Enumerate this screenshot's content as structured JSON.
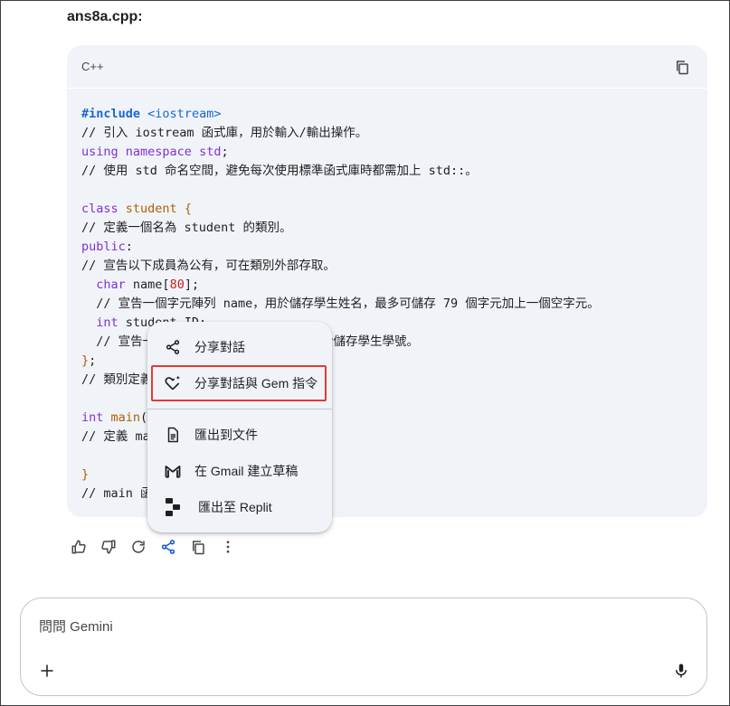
{
  "response": {
    "filename": "ans8a.cpp:"
  },
  "code_block": {
    "language": "C++",
    "copy_icon": "copy-icon",
    "lines": [
      [
        {
          "c": "kw",
          "t": "#include"
        },
        {
          "c": "",
          "t": " "
        },
        {
          "c": "str",
          "t": "<iostream>"
        }
      ],
      [
        {
          "c": "cm",
          "t": "// 引入 iostream 函式庫，用於輸入/輸出操作。"
        }
      ],
      [
        {
          "c": "kw2",
          "t": "using"
        },
        {
          "c": "",
          "t": " "
        },
        {
          "c": "kw2",
          "t": "namespace"
        },
        {
          "c": "",
          "t": " "
        },
        {
          "c": "kw2",
          "t": "std"
        },
        {
          "c": "",
          "t": ";"
        }
      ],
      [
        {
          "c": "cm",
          "t": "// 使用 std 命名空間，避免每次使用標準函式庫時都需加上 std::。"
        }
      ],
      [
        {
          "c": "",
          "t": " "
        }
      ],
      [
        {
          "c": "kw2",
          "t": "class"
        },
        {
          "c": "",
          "t": " "
        },
        {
          "c": "ty",
          "t": "student"
        },
        {
          "c": "",
          "t": " "
        },
        {
          "c": "ty",
          "t": "{"
        }
      ],
      [
        {
          "c": "cm",
          "t": "// 定義一個名為 student 的類別。"
        }
      ],
      [
        {
          "c": "kw2",
          "t": "public"
        },
        {
          "c": "",
          "t": ":"
        }
      ],
      [
        {
          "c": "cm",
          "t": "// 宣告以下成員為公有，可在類別外部存取。"
        }
      ],
      [
        {
          "c": "",
          "t": "  "
        },
        {
          "c": "kw2",
          "t": "char"
        },
        {
          "c": "",
          "t": " name["
        },
        {
          "c": "num",
          "t": "80"
        },
        {
          "c": "",
          "t": "];"
        }
      ],
      [
        {
          "c": "cm",
          "t": "  // 宣告一個字元陣列 name，用於儲存學生姓名，最多可儲存 79 個字元加上一個空字元。"
        }
      ],
      [
        {
          "c": "",
          "t": "  "
        },
        {
          "c": "kw2",
          "t": "int"
        },
        {
          "c": "",
          "t": " student_ID;"
        }
      ],
      [
        {
          "c": "cm",
          "t": "  // 宣告一個整數變數 student_ID，用於儲存學生學號。"
        }
      ],
      [
        {
          "c": "ty",
          "t": "}"
        },
        {
          "c": "",
          "t": ";"
        }
      ],
      [
        {
          "c": "cm",
          "t": "// 類別定義結束。"
        }
      ],
      [
        {
          "c": "",
          "t": " "
        }
      ],
      [
        {
          "c": "kw2",
          "t": "int"
        },
        {
          "c": "",
          "t": " "
        },
        {
          "c": "ty",
          "t": "main"
        },
        {
          "c": "",
          "t": "() {"
        }
      ],
      [
        {
          "c": "cm",
          "t": "// 定義 main 函式。"
        }
      ],
      [
        {
          "c": "",
          "t": " "
        }
      ],
      [
        {
          "c": "ty",
          "t": "}"
        }
      ],
      [
        {
          "c": "cm",
          "t": "// main 函式結束。"
        }
      ]
    ]
  },
  "actions": {
    "thumbs_up": "thumbs-up-icon",
    "thumbs_down": "thumbs-down-icon",
    "regenerate": "refresh-icon",
    "share": "share-icon",
    "copy": "copy-icon",
    "more": "more-vertical-icon"
  },
  "share_menu": {
    "items": [
      {
        "label": "分享對話",
        "icon": "share-icon"
      },
      {
        "label": "分享對話與 Gem 指令",
        "icon": "gem-heart-icon"
      },
      {
        "label": "匯出到文件",
        "icon": "docs-icon"
      },
      {
        "label": "在 Gmail 建立草稿",
        "icon": "gmail-icon"
      },
      {
        "label": "匯出至 Replit",
        "icon": "replit-icon"
      }
    ],
    "highlighted_index": 1
  },
  "input": {
    "placeholder": "問問 Gemini"
  },
  "colors": {
    "accent": "#0b57d0",
    "highlight_border": "#e53935",
    "code_bg": "#f0f4f9"
  }
}
